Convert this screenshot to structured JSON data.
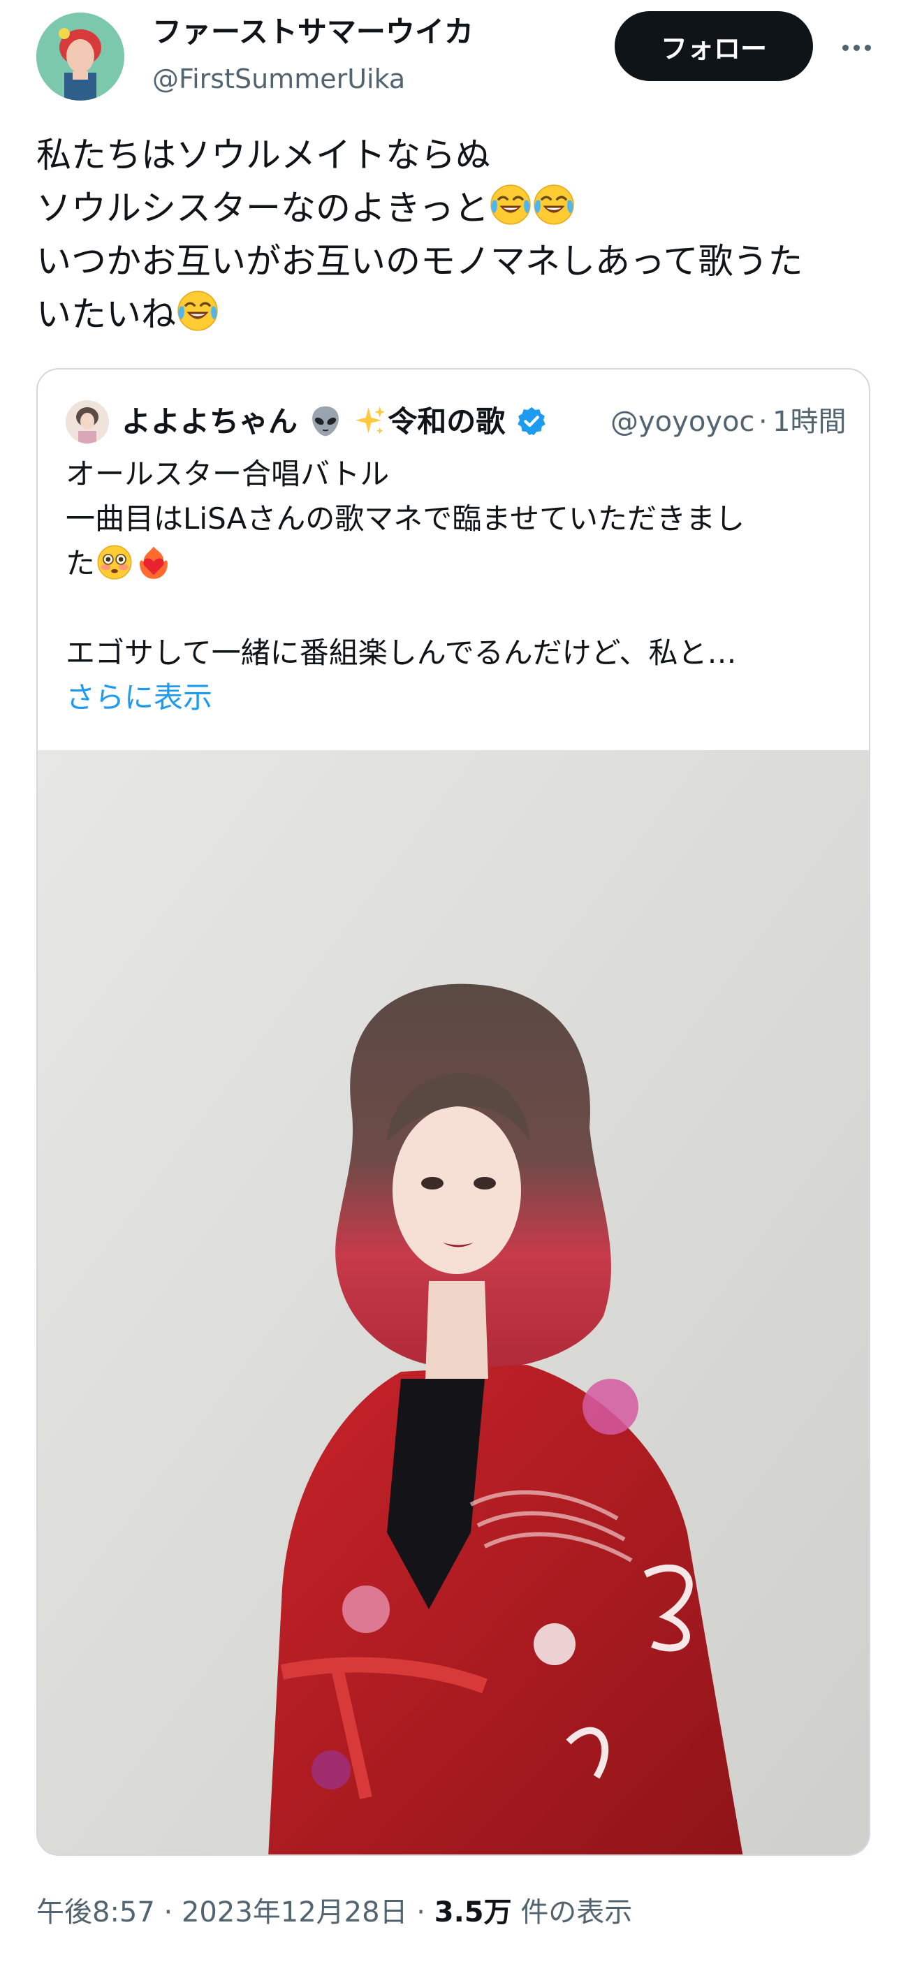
{
  "author": {
    "display_name": "ファーストサマーウイカ",
    "handle": "@FirstSummerUika",
    "follow_label": "フォロー"
  },
  "tweet": {
    "lines": [
      "私たちはソウルメイトならぬ",
      "ソウルシスターなのよきっと",
      "いつかお互いがお互いのモノマネしあって歌うた",
      "いたいね"
    ],
    "emojis": [
      "face-with-tears-of-joy",
      "face-with-tears-of-joy",
      "face-with-tears-of-joy"
    ]
  },
  "quote": {
    "display_name": "よよよちゃん",
    "name_suffix": "令和の歌",
    "handle": "@yoyoyoc",
    "separator": "·",
    "time": "1時間",
    "lines": [
      "オールスター合唱バトル",
      "一曲目はLiSAさんの歌マネで臨ませていただきまし",
      "た",
      "",
      "エゴサして一緒に番組楽しんでるんだけど、私と…"
    ],
    "show_more": "さらに表示",
    "icons": [
      "alien-icon",
      "sparkles-icon",
      "verified-badge-icon",
      "flushed-face-icon",
      "heart-on-fire-icon"
    ]
  },
  "meta": {
    "time": "午後8:57",
    "date": "2023年12月28日",
    "separator": "·",
    "views_count": "3.5万",
    "views_label": "件の表示"
  },
  "colors": {
    "text": "#0f1419",
    "secondary": "#536471",
    "link": "#1d9bf0",
    "border": "#cfd9de",
    "robe": "#b51a1f"
  }
}
